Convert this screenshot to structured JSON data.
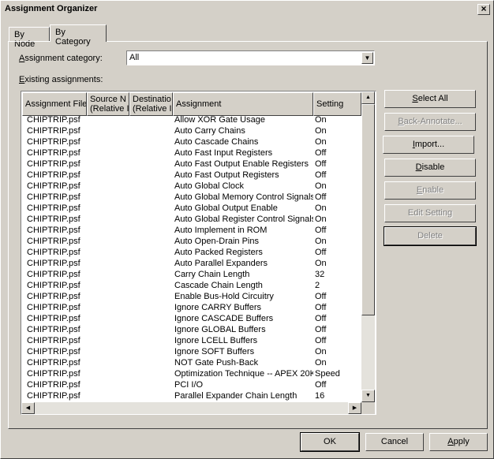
{
  "window": {
    "title": "Assignment Organizer",
    "close_glyph": "×"
  },
  "tabs": [
    {
      "label": "By Node"
    },
    {
      "label": "By Category"
    }
  ],
  "category": {
    "label_prefix": "A",
    "label_rest": "ssignment category:",
    "value": "All"
  },
  "existing": {
    "label_prefix": "E",
    "label_rest": "xisting assignments:"
  },
  "columns": [
    {
      "label": "Assignment File"
    },
    {
      "label": "Source N...(Relative I"
    },
    {
      "label": "Destinatio(Relative I"
    },
    {
      "label": "Assignment"
    },
    {
      "label": "Setting"
    }
  ],
  "columns_lines": {
    "c1": [
      "Source N",
      "(Relative I"
    ],
    "c2": [
      "Destinatio",
      "(Relative I"
    ]
  },
  "rows": [
    {
      "file": "CHIPTRIP.psf",
      "assignment": "Allow XOR Gate Usage",
      "setting": "On"
    },
    {
      "file": "CHIPTRIP.psf",
      "assignment": "Auto Carry Chains",
      "setting": "On"
    },
    {
      "file": "CHIPTRIP.psf",
      "assignment": "Auto Cascade Chains",
      "setting": "On"
    },
    {
      "file": "CHIPTRIP.psf",
      "assignment": "Auto Fast Input Registers",
      "setting": "Off"
    },
    {
      "file": "CHIPTRIP.psf",
      "assignment": "Auto Fast Output Enable Registers",
      "setting": "Off"
    },
    {
      "file": "CHIPTRIP.psf",
      "assignment": "Auto Fast Output Registers",
      "setting": "Off"
    },
    {
      "file": "CHIPTRIP.psf",
      "assignment": "Auto Global Clock",
      "setting": "On"
    },
    {
      "file": "CHIPTRIP.psf",
      "assignment": "Auto Global Memory Control Signals",
      "setting": "Off"
    },
    {
      "file": "CHIPTRIP.psf",
      "assignment": "Auto Global Output Enable",
      "setting": "On"
    },
    {
      "file": "CHIPTRIP.psf",
      "assignment": "Auto Global Register Control Signals",
      "setting": "On"
    },
    {
      "file": "CHIPTRIP.psf",
      "assignment": "Auto Implement in ROM",
      "setting": "Off"
    },
    {
      "file": "CHIPTRIP.psf",
      "assignment": "Auto Open-Drain Pins",
      "setting": "On"
    },
    {
      "file": "CHIPTRIP.psf",
      "assignment": "Auto Packed Registers",
      "setting": "Off"
    },
    {
      "file": "CHIPTRIP.psf",
      "assignment": "Auto Parallel Expanders",
      "setting": "On"
    },
    {
      "file": "CHIPTRIP.psf",
      "assignment": "Carry Chain Length",
      "setting": "32"
    },
    {
      "file": "CHIPTRIP.psf",
      "assignment": "Cascade Chain Length",
      "setting": "2"
    },
    {
      "file": "CHIPTRIP.psf",
      "assignment": "Enable Bus-Hold Circuitry",
      "setting": "Off"
    },
    {
      "file": "CHIPTRIP.psf",
      "assignment": "Ignore CARRY Buffers",
      "setting": "Off"
    },
    {
      "file": "CHIPTRIP.psf",
      "assignment": "Ignore CASCADE Buffers",
      "setting": "Off"
    },
    {
      "file": "CHIPTRIP.psf",
      "assignment": "Ignore GLOBAL Buffers",
      "setting": "Off"
    },
    {
      "file": "CHIPTRIP.psf",
      "assignment": "Ignore LCELL Buffers",
      "setting": "Off"
    },
    {
      "file": "CHIPTRIP.psf",
      "assignment": "Ignore SOFT Buffers",
      "setting": "On"
    },
    {
      "file": "CHIPTRIP.psf",
      "assignment": "NOT Gate Push-Back",
      "setting": "On"
    },
    {
      "file": "CHIPTRIP.psf",
      "assignment": "Optimization Technique -- APEX 20K",
      "setting": "Speed"
    },
    {
      "file": "CHIPTRIP.psf",
      "assignment": "PCI I/O",
      "setting": "Off"
    },
    {
      "file": "CHIPTRIP.psf",
      "assignment": "Parallel Expander Chain Length",
      "setting": "16"
    }
  ],
  "side_buttons": {
    "select_all": {
      "u": "S",
      "rest": "elect All"
    },
    "back_annotate": {
      "u": "B",
      "rest": "ack-Annotate..."
    },
    "import": {
      "u": "I",
      "rest": "mport..."
    },
    "disable": {
      "u": "D",
      "rest": "isable"
    },
    "enable": {
      "u": "E",
      "rest": "nable"
    },
    "edit_setting": {
      "label": "Edit Setting"
    },
    "delete": {
      "label": "Delete"
    }
  },
  "footer": {
    "ok": "OK",
    "cancel": "Cancel",
    "apply_u": "A",
    "apply_rest": "pply"
  },
  "icons": {
    "combo_arrow": "▼",
    "scroll_up": "▲",
    "scroll_down": "▼",
    "scroll_left": "◀",
    "scroll_right": "▶"
  }
}
